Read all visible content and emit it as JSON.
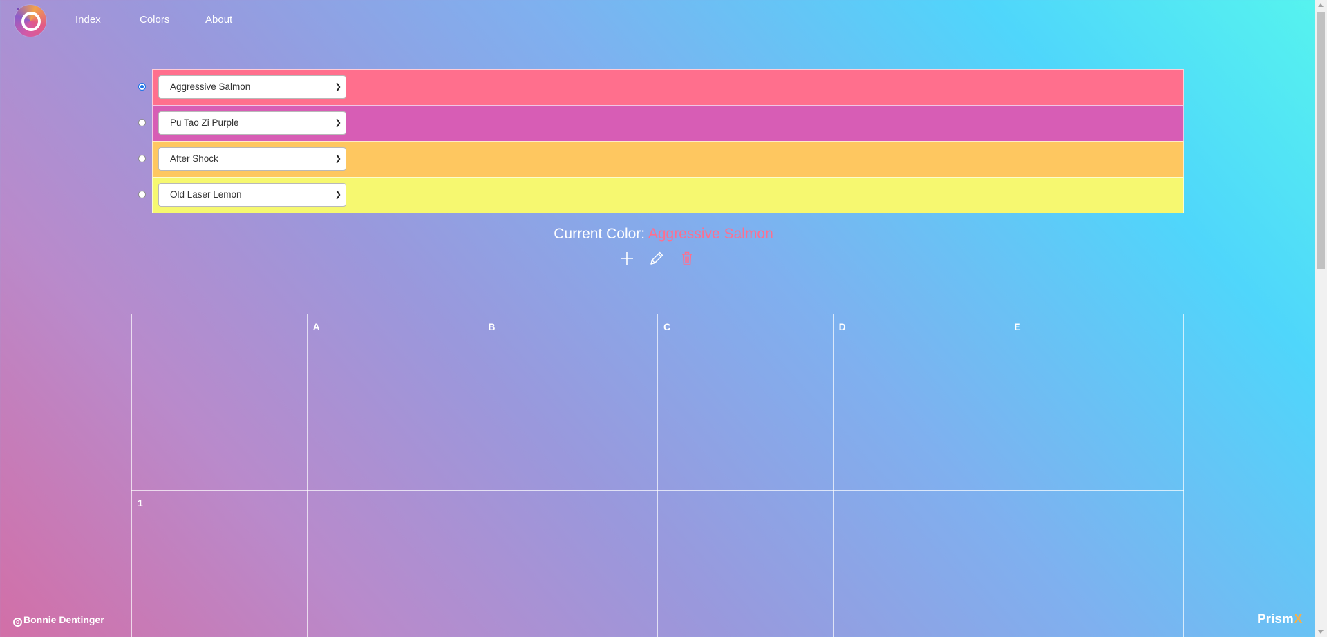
{
  "nav": {
    "logo_icon": "prism-logo",
    "items": [
      "Index",
      "Colors",
      "About"
    ]
  },
  "palette": {
    "rows": [
      {
        "name": "Aggressive Salmon",
        "color": "#ff6f8d",
        "selected": true
      },
      {
        "name": "Pu Tao Zi Purple",
        "color": "#d75db5",
        "selected": false
      },
      {
        "name": "After Shock",
        "color": "#fec760",
        "selected": false
      },
      {
        "name": "Old Laser Lemon",
        "color": "#f6f870",
        "selected": false
      }
    ]
  },
  "current_color": {
    "label": "Current Color:",
    "value": "Aggressive Salmon",
    "value_color": "#ff6e8e"
  },
  "actions": {
    "add_icon": "plus-icon",
    "edit_icon": "pencil-icon",
    "delete_icon": "trash-icon",
    "delete_color": "#ff6e8e"
  },
  "grid": {
    "columns": [
      "",
      "A",
      "B",
      "C",
      "D",
      "E"
    ],
    "rows": [
      "1"
    ]
  },
  "footer": {
    "copyright": "Bonnie Dentinger",
    "brand_main": "Prism",
    "brand_accent": "X",
    "brand_accent_color": "#f5b14b"
  }
}
